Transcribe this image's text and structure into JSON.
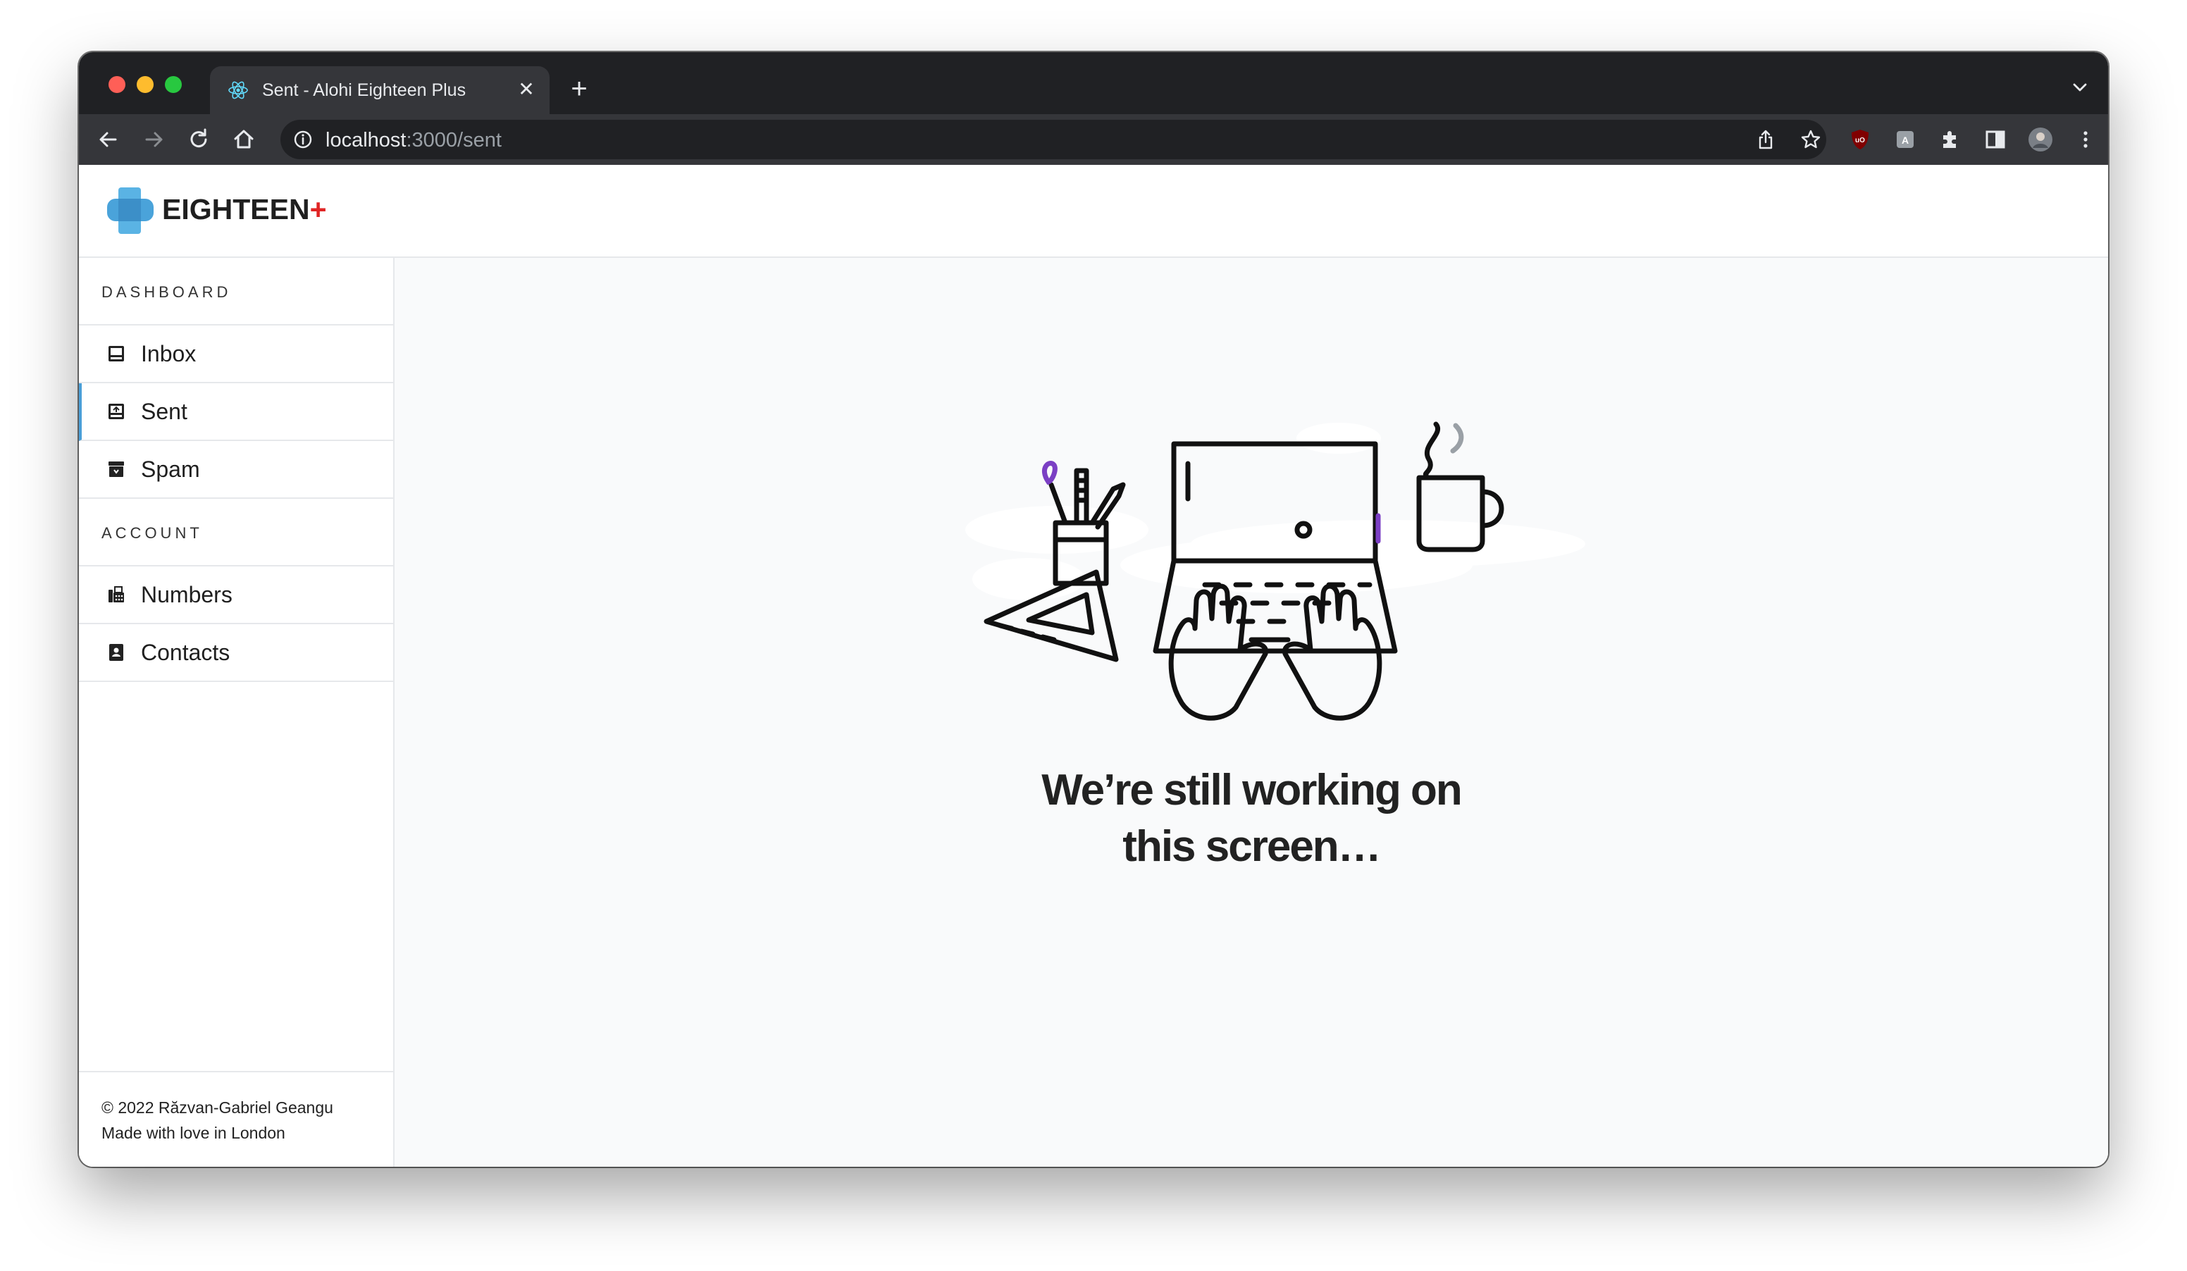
{
  "browser": {
    "tab_title": "Sent - Alohi Eighteen Plus",
    "url_host": "localhost",
    "url_path": ":3000/sent"
  },
  "app": {
    "logo_text": "EIGHTEEN",
    "logo_plus": "+",
    "sidebar": {
      "sections": [
        {
          "title": "DASHBOARD",
          "items": [
            {
              "label": "Inbox",
              "icon": "inbox-icon"
            },
            {
              "label": "Sent",
              "icon": "sent-icon",
              "active": true
            },
            {
              "label": "Spam",
              "icon": "spam-icon"
            }
          ]
        },
        {
          "title": "ACCOUNT",
          "items": [
            {
              "label": "Numbers",
              "icon": "fax-icon"
            },
            {
              "label": "Contacts",
              "icon": "contacts-icon"
            }
          ]
        }
      ],
      "footer_line1": "© 2022 Răzvan-Gabriel Geangu",
      "footer_line2": "Made with love in London"
    },
    "main": {
      "message_line1": "We’re still working on",
      "message_line2": "this screen…"
    }
  },
  "colors": {
    "accent": "#4a9fd8",
    "brand_plus": "#e02424",
    "purple": "#7b3fc4"
  }
}
